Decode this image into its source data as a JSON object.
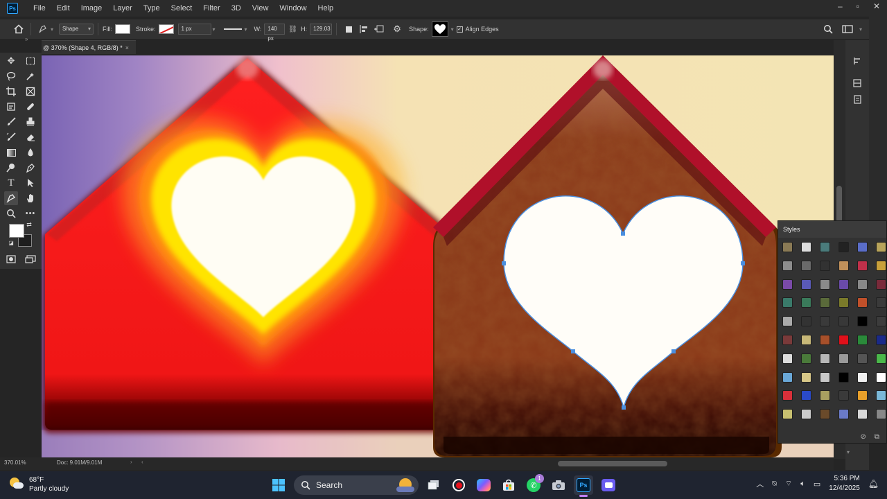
{
  "app": {
    "logo": "Ps"
  },
  "menu": [
    "File",
    "Edit",
    "Image",
    "Layer",
    "Type",
    "Select",
    "Filter",
    "3D",
    "View",
    "Window",
    "Help"
  ],
  "options": {
    "mode": "Shape",
    "fill_label": "Fill:",
    "stroke_label": "Stroke:",
    "stroke_width": "1 px",
    "w_label": "W:",
    "w_value": "140 px",
    "h_label": "H:",
    "h_value": "129.03",
    "shape_label": "Shape:",
    "align_edges": "Align Edges",
    "align_edges_checked": true
  },
  "document_tab": {
    "title": "@ 370% (Shape 4, RGB/8) *",
    "close": "×"
  },
  "styles_panel": {
    "title": "Styles",
    "swatches": [
      [
        "#8a7a55",
        "#dddddd",
        "#4a7b7b",
        "#222222",
        "#5a6dc8",
        "#b8a45a"
      ],
      [
        "#8c8c8c",
        "#6a6a6a",
        "#323232",
        "#c0905a",
        "#c0304a",
        "#c8a03a"
      ],
      [
        "#7a4aa8",
        "#5a5ab8",
        "#8a8a8a",
        "#6a4aa8",
        "#888888",
        "#7a2a3a"
      ],
      [
        "#3a7a6a",
        "#3a7a5a",
        "#5a6a3a",
        "#7a7a2a",
        "#c0502a",
        "#3a3a3a"
      ],
      [
        "#aaaaaa",
        "#333333",
        "#3a3a3a",
        "#383838",
        "#000000",
        "#3c3c3c"
      ],
      [
        "#7a3a3a",
        "#c8b878",
        "#a8502a",
        "#e0101a",
        "#2a8a3a",
        "#1a2a8a"
      ],
      [
        "#dcdcdc",
        "#4a7a3a",
        "#b8b8b8",
        "#9a9a9a",
        "#555555",
        "#4ab84a"
      ],
      [
        "#6aa8d8",
        "#d8c888",
        "#c8c8c8",
        "#000000",
        "#f0f0f0",
        "#ffffff"
      ],
      [
        "#d8303a",
        "#2a4ac8",
        "#a8a060",
        "#3a3a3a",
        "#e8a02a",
        "#7ab8d8"
      ],
      [
        "#c8c070",
        "#cccccc",
        "#6a4a2a",
        "#6a7ac8",
        "#d8d8d8",
        "#888888"
      ]
    ]
  },
  "status": {
    "zoom": "370.01%",
    "doc": "Doc: 9.01M/9.01M",
    "arrow": "›",
    "arrow2": "‹"
  },
  "taskbar": {
    "temp": "68°F",
    "weather": "Partly cloudy",
    "search": "Search",
    "time": "5:36 PM",
    "date": "12/4/2025",
    "badge": "1"
  },
  "colors": {
    "accent": "#31a8ff",
    "red_house": "#f01818",
    "brown_house": "#8a3a1a",
    "path": "#4a8fe0"
  }
}
